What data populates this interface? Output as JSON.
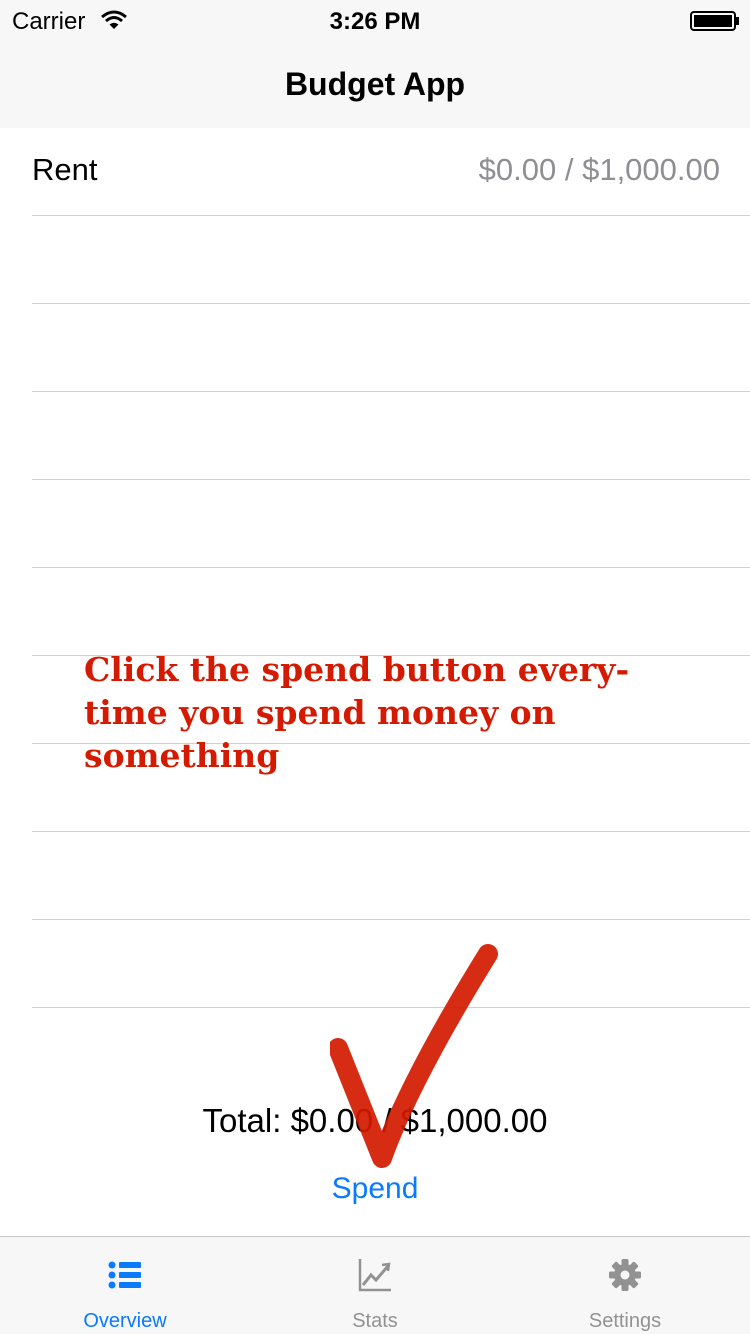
{
  "status_bar": {
    "carrier": "Carrier",
    "time": "3:26 PM"
  },
  "nav": {
    "title": "Budget App"
  },
  "budget_rows": [
    {
      "label": "Rent",
      "value": "$0.00 / $1,000.00"
    }
  ],
  "footer": {
    "total": "Total: $0.00 / $1,000.00",
    "spend_label": "Spend"
  },
  "annotation": {
    "text": "Click the spend button every-time you spend money on something"
  },
  "tabs": [
    {
      "label": "Overview",
      "icon": "list-icon",
      "active": true
    },
    {
      "label": "Stats",
      "icon": "chart-icon",
      "active": false
    },
    {
      "label": "Settings",
      "icon": "gear-icon",
      "active": false
    }
  ],
  "colors": {
    "accent": "#0a7aff",
    "annotation": "#d41a00",
    "secondary_text": "#8e8e93"
  }
}
